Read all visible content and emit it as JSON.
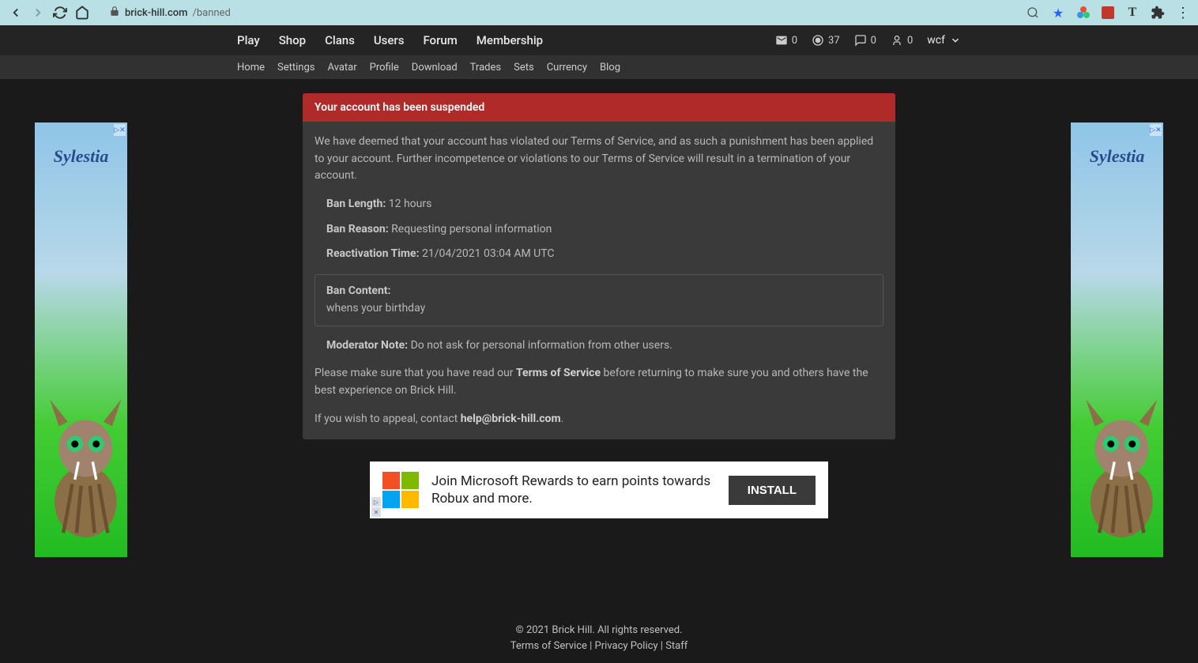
{
  "browser": {
    "domain": "brick-hill.com",
    "path": "/banned"
  },
  "topnav": {
    "items": [
      "Play",
      "Shop",
      "Clans",
      "Users",
      "Forum",
      "Membership"
    ],
    "stats": {
      "messages": "0",
      "currency": "37",
      "friends": "0",
      "notifications": "0"
    },
    "username": "wcf"
  },
  "subnav": {
    "items": [
      "Home",
      "Settings",
      "Avatar",
      "Profile",
      "Download",
      "Trades",
      "Sets",
      "Currency",
      "Blog"
    ]
  },
  "card": {
    "title": "Your account has been suspended",
    "intro": "We have deemed that your account has violated our Terms of Service, and as such a punishment has been applied to your account. Further incompetence or violations to our Terms of Service will result in a termination of your account.",
    "length_label": "Ban Length:",
    "length_value": " 12 hours",
    "reason_label": "Ban Reason:",
    "reason_value": " Requesting personal information",
    "reactivation_label": "Reactivation Time:",
    "reactivation_value": " 21/04/2021 03:04 AM UTC",
    "content_label": "Ban Content:",
    "content_value": "whens your birthday",
    "moderator_label": "Moderator Note:",
    "moderator_value": " Do not ask for personal information from other users.",
    "please_before": "Please make sure that you have read our ",
    "tos_link": "Terms of Service",
    "please_after": " before returning to make sure you and others have the best experience on Brick Hill.",
    "appeal_before": "If you wish to appeal, contact ",
    "appeal_email": "help@brick-hill.com",
    "appeal_after": "."
  },
  "ads": {
    "side_brand": "Sylestia",
    "banner_text": "Join Microsoft Rewards to earn points towards Robux and more.",
    "install_label": "INSTALL"
  },
  "footer": {
    "copyright": "© 2021 Brick Hill. All rights reserved.",
    "tos": "Terms of Service",
    "privacy": "Privacy Policy",
    "staff": "Staff",
    "sep": " | "
  }
}
